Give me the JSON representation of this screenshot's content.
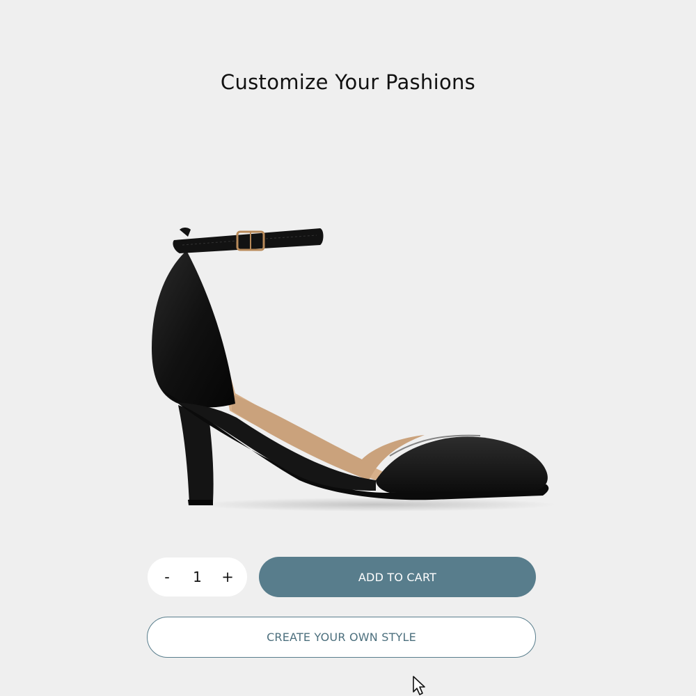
{
  "page": {
    "title": "Customize Your Pashions",
    "background": "#efefef"
  },
  "product": {
    "image_icon": "black-ankle-strap-heel-shoe"
  },
  "quantity": {
    "decrement_label": "-",
    "value": "1",
    "increment_label": "+"
  },
  "actions": {
    "add_to_cart_label": "ADD TO CART",
    "create_style_label": "CREATE YOUR OWN STYLE",
    "accent_color": "#587d8c"
  },
  "cursor": {
    "icon": "mouse-pointer-icon"
  }
}
